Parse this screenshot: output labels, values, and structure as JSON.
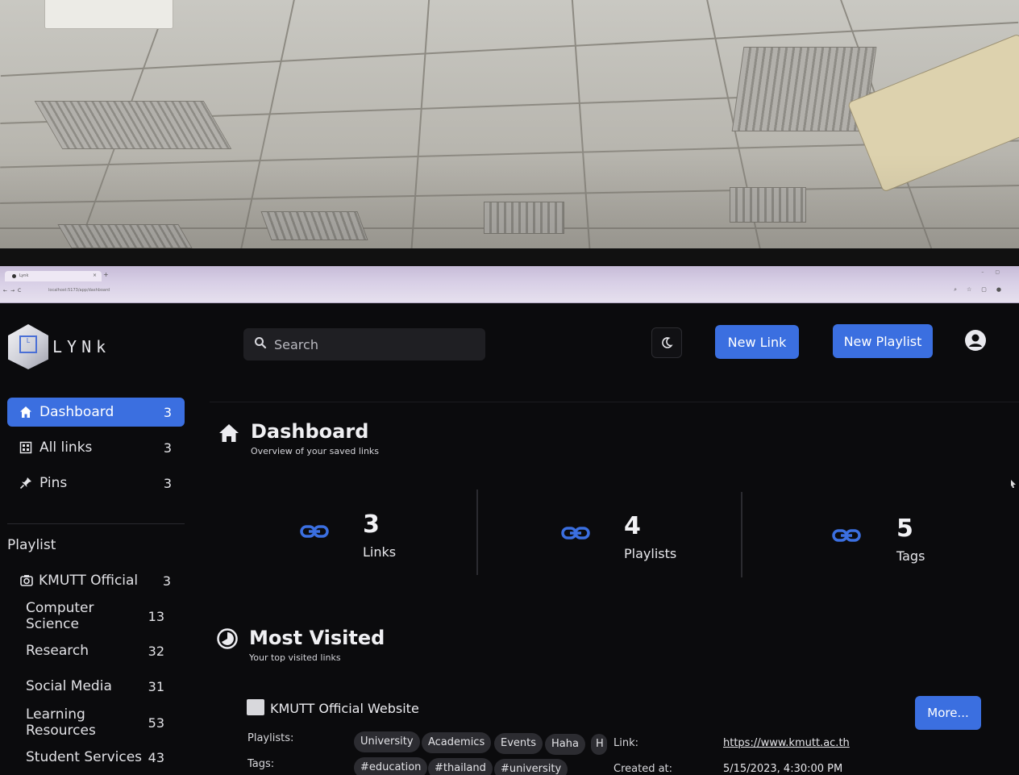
{
  "browser": {
    "tab_title": "Lynk",
    "url": "localhost:5173/app/dashboard"
  },
  "app": {
    "logo_text": "LYNk",
    "search": {
      "placeholder": "Search",
      "value": ""
    },
    "theme_toggle_icon": "moon-icon",
    "new_link_label": "New Link",
    "new_playlist_label": "New Playlist",
    "accent_color": "#3b6fe0"
  },
  "sidebar": {
    "nav": [
      {
        "label": "Dashboard",
        "count": "3",
        "icon": "home-icon",
        "active": true
      },
      {
        "label": "All links",
        "count": "3",
        "icon": "grid-icon",
        "active": false
      },
      {
        "label": "Pins",
        "count": "3",
        "icon": "pin-icon",
        "active": false
      }
    ],
    "playlist_heading": "Playlist",
    "playlists": [
      {
        "label": "KMUTT Official",
        "count": "3"
      },
      {
        "label": "Computer Science",
        "count": "13"
      },
      {
        "label": "Research",
        "count": "32"
      },
      {
        "label": "Social Media",
        "count": "31"
      },
      {
        "label": "Learning Resources",
        "count": "53"
      },
      {
        "label": "Student Services",
        "count": "43"
      }
    ]
  },
  "dashboard": {
    "title": "Dashboard",
    "subtitle": "Overview of your saved links",
    "stats": [
      {
        "value": "3",
        "label": "Links"
      },
      {
        "value": "4",
        "label": "Playlists"
      },
      {
        "value": "5",
        "label": "Tags"
      }
    ]
  },
  "most_visited": {
    "title": "Most Visited",
    "subtitle": "Your top visited links",
    "item": {
      "title": "KMUTT Official Website",
      "playlists_label": "Playlists:",
      "playlists": [
        "University",
        "Academics",
        "Events",
        "Haha",
        "H"
      ],
      "tags_label": "Tags:",
      "tags": [
        "#education",
        "#thailand",
        "#university"
      ],
      "link_label": "Link:",
      "link": "https://www.kmutt.ac.th",
      "created_label": "Created at:",
      "created": "5/15/2023, 4:30:00 PM",
      "more_label": "More..."
    }
  }
}
